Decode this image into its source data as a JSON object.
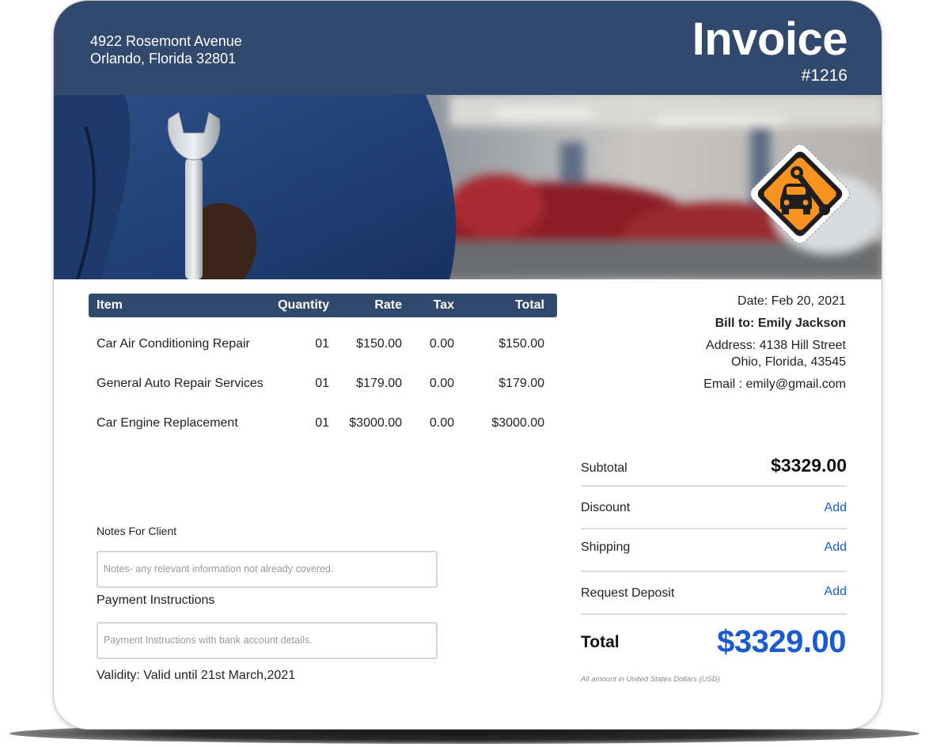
{
  "header": {
    "address_line1": "4922 Rosemont Avenue",
    "address_line2": "Orlando, Florida 32801",
    "title": "Invoice",
    "number": "#1216"
  },
  "banner": {
    "logo_icon": "car-repair-sign-icon",
    "logo_color": "#f7931e"
  },
  "table": {
    "headers": {
      "item": "Item",
      "quantity": "Quantity",
      "rate": "Rate",
      "tax": "Tax",
      "total": "Total"
    },
    "rows": [
      {
        "item": "Car Air Conditioning Repair",
        "quantity": "01",
        "rate": "$150.00",
        "tax": "0.00",
        "total": "$150.00"
      },
      {
        "item": "General Auto Repair Services",
        "quantity": "01",
        "rate": "$179.00",
        "tax": "0.00",
        "total": "$179.00"
      },
      {
        "item": "Car Engine Replacement",
        "quantity": "01",
        "rate": "$3000.00",
        "tax": "0.00",
        "total": "$3000.00"
      }
    ]
  },
  "client": {
    "date": "Date: Feb 20, 2021",
    "bill_to": "Bill to: Emily Jackson",
    "address_line1": "Address: 4138 Hill Street",
    "address_line2": "Ohio, Florida, 43545",
    "email": "Email : emily@gmail.com"
  },
  "notes": {
    "label": "Notes For Client",
    "placeholder": "Notes- any relevant information not already covered."
  },
  "payment": {
    "label": "Payment Instructions",
    "placeholder": "Payment Instructions with bank account details."
  },
  "validity": "Validity: Valid until 21st March,2021",
  "summary": {
    "subtotal_label": "Subtotal",
    "subtotal_value": "$3329.00",
    "discount_label": "Discount",
    "shipping_label": "Shipping",
    "deposit_label": "Request Deposit",
    "add_label": "Add",
    "total_label": "Total",
    "total_value": "$3329.00",
    "currency_note": "All amount in United States Dollars (USD)"
  },
  "colors": {
    "header_bg": "#30496d",
    "accent_blue": "#1a5bd1"
  }
}
